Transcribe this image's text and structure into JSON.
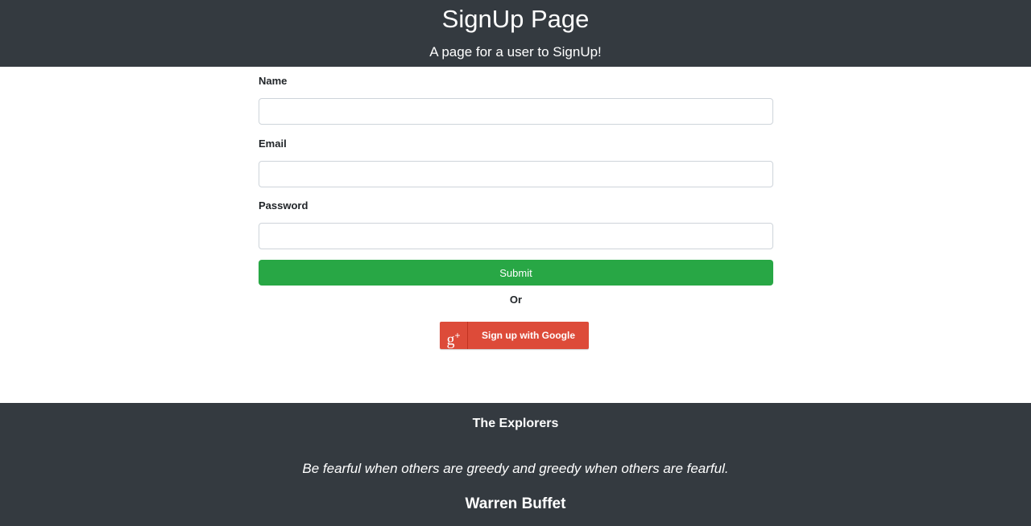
{
  "header": {
    "title": "SignUp Page",
    "subtitle": "A page for a user to SignUp!"
  },
  "form": {
    "name_label": "Name",
    "name_value": "",
    "email_label": "Email",
    "email_value": "",
    "password_label": "Password",
    "password_value": "",
    "submit_label": "Submit",
    "or_text": "Or"
  },
  "google": {
    "icon_glyph": "g",
    "icon_plus": "+",
    "label": "Sign up with Google",
    "color": "#dd4b39"
  },
  "footer": {
    "team": "The Explorers",
    "quote": "Be fearful when others are greedy and greedy when others are fearful.",
    "author": "Warren Buffet"
  },
  "colors": {
    "header_bg": "#343a40",
    "submit_bg": "#28a745"
  }
}
